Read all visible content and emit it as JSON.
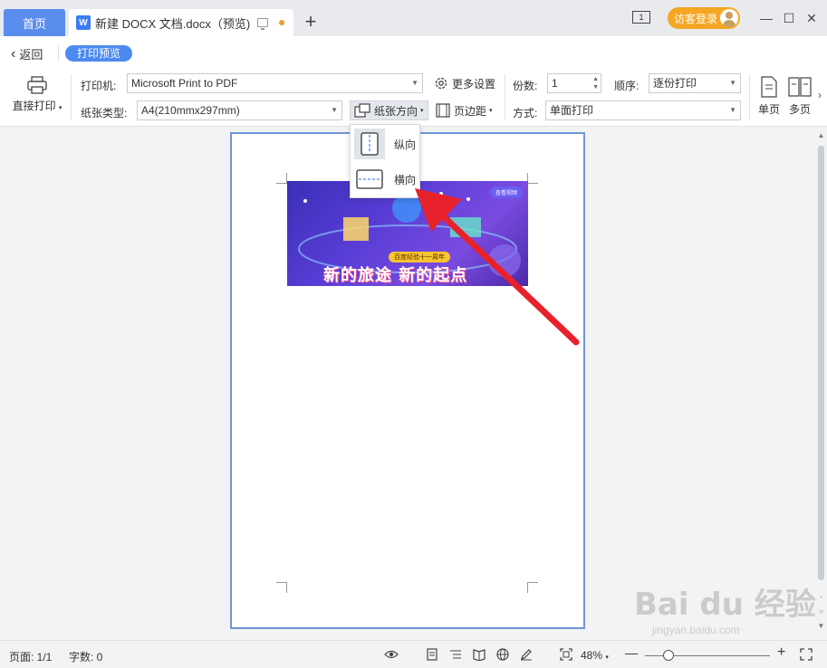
{
  "tabs": {
    "home": "首页",
    "document": "新建 DOCX 文档.docx（预览)",
    "add": "+"
  },
  "titlebar": {
    "page_count_icon": "1",
    "visitor_login": "访客登录",
    "minimize": "—",
    "maximize": "☐",
    "close": "✕"
  },
  "subbar": {
    "back": "返回",
    "mode": "打印预览"
  },
  "toolbar": {
    "direct_print": "直接打印",
    "printer_label": "打印机:",
    "printer_value": "Microsoft Print to PDF",
    "paper_label": "纸张类型:",
    "paper_value": "A4(210mmx297mm)",
    "more_settings": "更多设置",
    "orientation": "纸张方向",
    "margins": "页边距",
    "copies_label": "份数:",
    "copies_value": "1",
    "order_label": "顺序:",
    "order_value": "逐份打印",
    "mode_label": "方式:",
    "mode_value": "单面打印",
    "single_page": "单页",
    "multi_page": "多页"
  },
  "dropdown": {
    "portrait": "纵向",
    "landscape": "横向"
  },
  "banner": {
    "tag": "百度经验十一周年",
    "headline": "新的旅途 新的起点",
    "pill": "查看视频"
  },
  "statusbar": {
    "page": "页面: 1/1",
    "words": "字数: 0",
    "zoom": "48%"
  },
  "watermark": {
    "main": "Bai du 经验",
    "sub": "jingyan.baidu.com"
  },
  "colors": {
    "accent": "#4d8af0",
    "arrow": "#e8222c",
    "visitor": "#f5a623",
    "page_border": "#6f95d6"
  }
}
